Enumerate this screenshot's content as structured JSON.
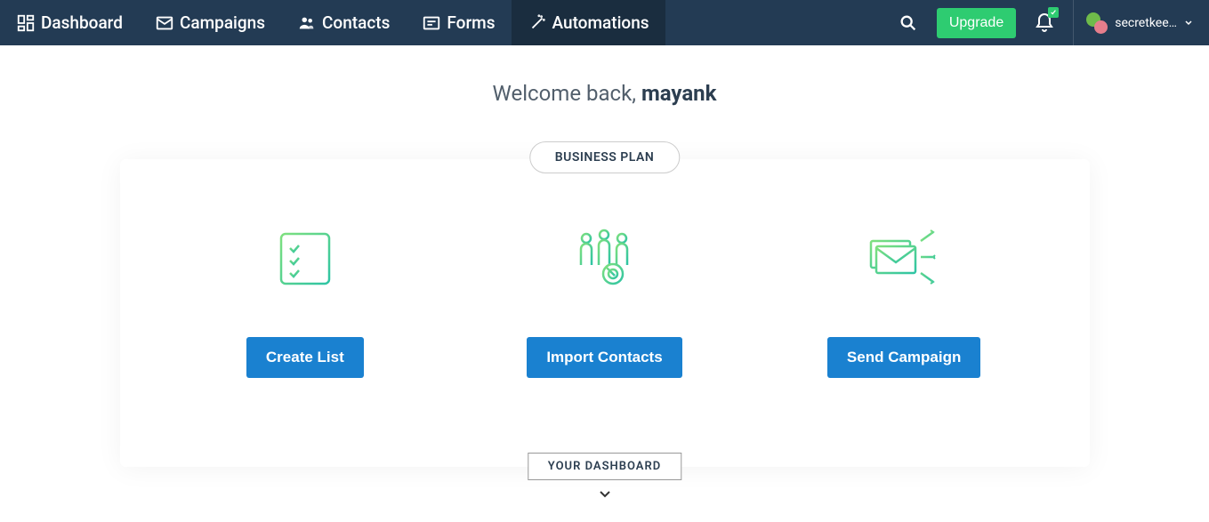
{
  "nav": {
    "items": [
      {
        "label": "Dashboard",
        "icon": "dashboard-icon",
        "active": false
      },
      {
        "label": "Campaigns",
        "icon": "envelope-icon",
        "active": false
      },
      {
        "label": "Contacts",
        "icon": "contacts-icon",
        "active": false
      },
      {
        "label": "Forms",
        "icon": "form-icon",
        "active": false
      },
      {
        "label": "Automations",
        "icon": "wand-icon",
        "active": true
      }
    ]
  },
  "header": {
    "upgrade_label": "Upgrade",
    "user_label": "secretkee…"
  },
  "welcome": {
    "prefix": "Welcome back, ",
    "username": "mayank"
  },
  "plan": {
    "label": "BUSINESS PLAN"
  },
  "actions": [
    {
      "label": "Create List",
      "icon": "list-icon"
    },
    {
      "label": "Import Contacts",
      "icon": "people-target-icon"
    },
    {
      "label": "Send Campaign",
      "icon": "send-mail-icon"
    }
  ],
  "dashboard_section": {
    "label": "YOUR DASHBOARD"
  },
  "colors": {
    "topbar_bg": "#233b54",
    "accent_green": "#2ecc71",
    "accent_blue": "#1a81d0",
    "icon_gradient_start": "#7ee07e",
    "icon_gradient_end": "#2ec4a4"
  }
}
